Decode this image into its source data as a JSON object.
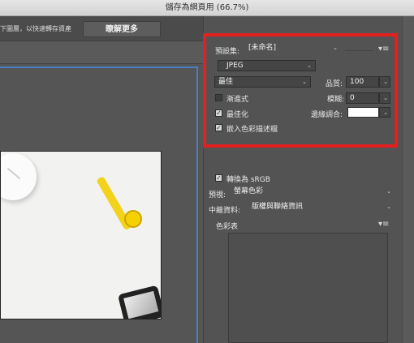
{
  "window": {
    "title": "儲存為網頁用 (66.7%)"
  },
  "topbar": {
    "hint": "下圖層，以快速轉存資產",
    "learn_more": "瞭解更多"
  },
  "settings": {
    "preset_label": "預設集:",
    "preset_value": "[未命名]",
    "format_value": "JPEG",
    "quality_preset": "最佳",
    "quality_label": "品質:",
    "quality_value": "100",
    "progressive_label": "漸進式",
    "progressive_checked": false,
    "blur_label": "模糊:",
    "blur_value": "0",
    "optimized_label": "最佳化",
    "optimized_checked": true,
    "matte_label": "邊緣調合:",
    "matte_color": "#ffffff",
    "embed_profile_label": "嵌入色彩描述檔",
    "embed_profile_checked": true
  },
  "color": {
    "convert_srgb_label": "轉換為 sRGB",
    "convert_srgb_checked": true,
    "preview_label": "預視:",
    "preview_value": "螢幕色彩",
    "metadata_label": "中繼資料:",
    "metadata_value": "版權與聯絡資訊",
    "color_table_label": "色彩表"
  },
  "colors": {
    "highlight": "#e41f1f",
    "frame": "#4a7ebf"
  }
}
